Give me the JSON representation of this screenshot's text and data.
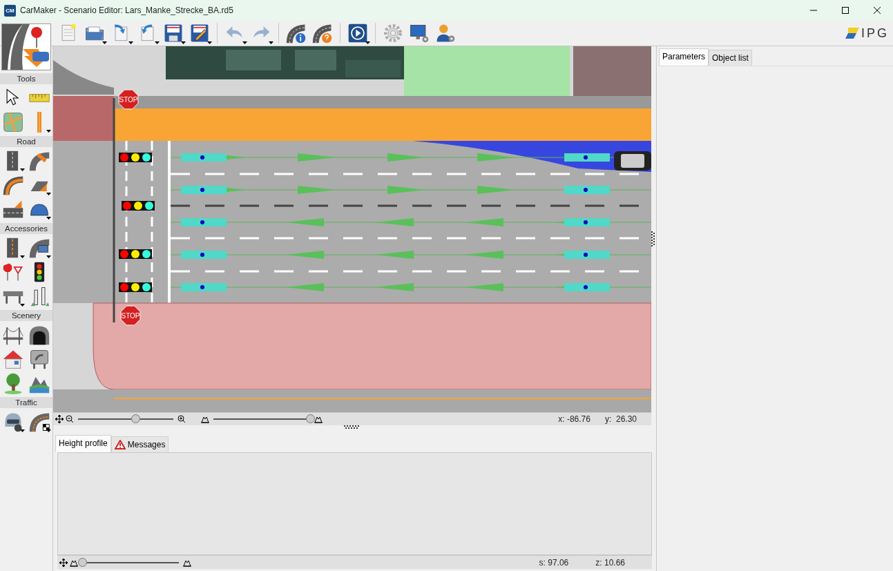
{
  "window": {
    "title": "CarMaker - Scenario Editor: Lars_Manke_Strecke_BA.rd5",
    "app_badge": "CM"
  },
  "toolbar": {
    "groups": [
      [
        {
          "kind": "new",
          "dropdown": false
        },
        {
          "kind": "open",
          "dropdown": true
        },
        {
          "kind": "import",
          "dropdown": true
        },
        {
          "kind": "export",
          "dropdown": true
        },
        {
          "kind": "save",
          "dropdown": true
        },
        {
          "kind": "saveas",
          "dropdown": true
        }
      ],
      [
        {
          "kind": "undo",
          "dropdown": true
        },
        {
          "kind": "redo",
          "dropdown": true
        }
      ],
      [
        {
          "kind": "roadinfo",
          "dropdown": false
        },
        {
          "kind": "roadhelp",
          "dropdown": false
        }
      ],
      [
        {
          "kind": "play",
          "dropdown": true
        }
      ],
      [
        {
          "kind": "settings",
          "dropdown": false
        },
        {
          "kind": "monitor",
          "dropdown": false
        },
        {
          "kind": "user",
          "dropdown": false
        }
      ]
    ]
  },
  "logo": "IPG",
  "palette": {
    "mode": {
      "kind": "mode"
    },
    "sections": [
      {
        "label": "Tools",
        "items": [
          {
            "kind": "pointer",
            "dropdown": false
          },
          {
            "kind": "ruler",
            "dropdown": false
          },
          {
            "kind": "map",
            "dropdown": false
          },
          {
            "kind": "marker",
            "dropdown": true
          }
        ]
      },
      {
        "label": "Road",
        "items": [
          {
            "kind": "straight",
            "dropdown": true
          },
          {
            "kind": "junction",
            "dropdown": false
          },
          {
            "kind": "curve",
            "dropdown": false
          },
          {
            "kind": "ramp",
            "dropdown": true
          },
          {
            "kind": "merge",
            "dropdown": false
          },
          {
            "kind": "bump",
            "dropdown": true
          }
        ]
      },
      {
        "label": "Accessories",
        "items": [
          {
            "kind": "marking",
            "dropdown": true
          },
          {
            "kind": "panel",
            "dropdown": true
          },
          {
            "kind": "stopsign",
            "dropdown": false
          },
          {
            "kind": "light",
            "dropdown": false
          },
          {
            "kind": "guardrail",
            "dropdown": true
          },
          {
            "kind": "posts",
            "dropdown": false
          }
        ]
      },
      {
        "label": "Scenery",
        "items": [
          {
            "kind": "bridge",
            "dropdown": false
          },
          {
            "kind": "tunnel",
            "dropdown": false
          },
          {
            "kind": "house",
            "dropdown": false
          },
          {
            "kind": "billboard",
            "dropdown": false
          },
          {
            "kind": "tree",
            "dropdown": false
          },
          {
            "kind": "landscape",
            "dropdown": false
          }
        ]
      },
      {
        "label": "Traffic",
        "items": [
          {
            "kind": "driver",
            "dropdown": true
          },
          {
            "kind": "route",
            "dropdown": true
          }
        ]
      }
    ]
  },
  "map": {
    "stop_signs": [
      "STOP",
      "STOP"
    ],
    "status": {
      "zoom_slider": {
        "level": 0.6
      },
      "height_slider": {
        "level": 1.0
      },
      "x": "x: -86.76",
      "y": "y:  26.30"
    }
  },
  "bottom_tabs": [
    {
      "label": "Height profile",
      "selected": true,
      "warning": false
    },
    {
      "label": "Messages",
      "selected": false,
      "warning": true
    }
  ],
  "height_profile": {
    "scale_slider": {
      "level": 0.0
    },
    "s": "s: 97.06",
    "z": "z: 10.66"
  },
  "right_tabs": [
    {
      "label": "Parameters",
      "selected": true
    },
    {
      "label": "Object list",
      "selected": false
    }
  ]
}
